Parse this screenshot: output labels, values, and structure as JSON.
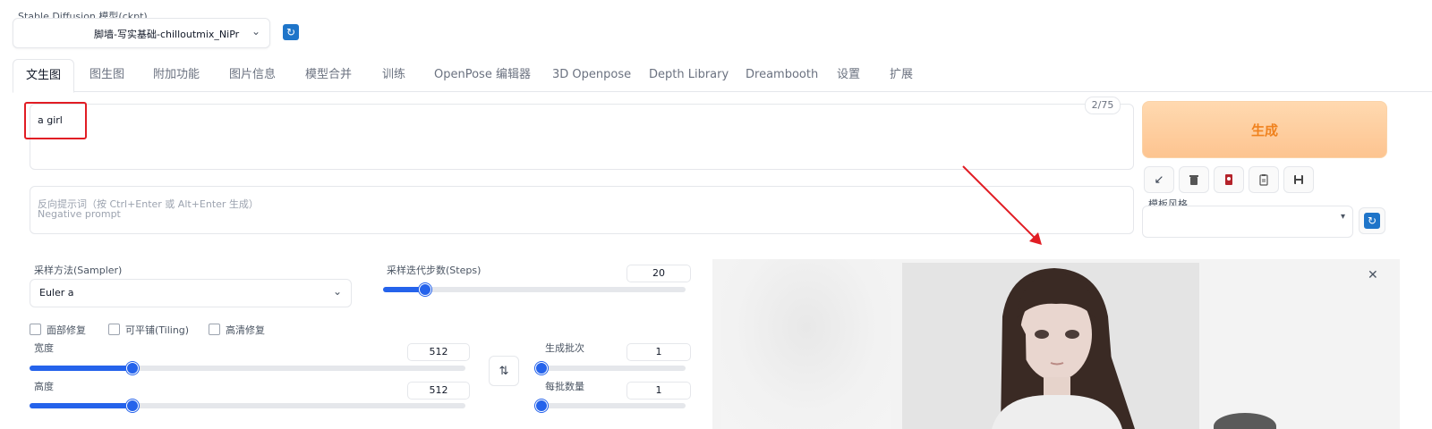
{
  "model": {
    "label": "Stable Diffusion 模型(ckpt)",
    "value": "脚墙-写实基础-chilloutmix_NiPr",
    "refresh_icon": "refresh-icon"
  },
  "tabs": [
    {
      "label": "文生图"
    },
    {
      "label": "图生图"
    },
    {
      "label": "附加功能"
    },
    {
      "label": "图片信息"
    },
    {
      "label": "模型合并"
    },
    {
      "label": "训练"
    },
    {
      "label": "OpenPose 编辑器"
    },
    {
      "label": "3D Openpose"
    },
    {
      "label": "Depth Library"
    },
    {
      "label": "Dreambooth"
    },
    {
      "label": "设置"
    },
    {
      "label": "扩展"
    }
  ],
  "prompt": {
    "value": "a girl",
    "token_counter": "2/75"
  },
  "negative_prompt": {
    "placeholder_line1": "反向提示词（按 Ctrl+Enter 或 Alt+Enter 生成）",
    "placeholder_line2": "Negative prompt"
  },
  "generate": {
    "label": "生成"
  },
  "tools": [
    "arrow-icon",
    "trash-icon",
    "card-icon",
    "clipboard-icon",
    "save-icon"
  ],
  "style": {
    "label": "模板风格",
    "value": ""
  },
  "sampler": {
    "label": "采样方法(Sampler)",
    "value": "Euler a"
  },
  "steps": {
    "label": "采样迭代步数(Steps)",
    "value": "20",
    "fraction": 0.135
  },
  "checkboxes": [
    {
      "label": "面部修复",
      "checked": false
    },
    {
      "label": "可平铺(Tiling)",
      "checked": false
    },
    {
      "label": "高清修复",
      "checked": false
    }
  ],
  "width": {
    "label": "宽度",
    "value": "512",
    "fraction": 0.235
  },
  "height": {
    "label": "高度",
    "value": "512",
    "fraction": 0.235
  },
  "batch_count": {
    "label": "生成批次",
    "value": "1",
    "fraction": 0.0
  },
  "batch_size": {
    "label": "每批数量",
    "value": "1",
    "fraction": 0.0
  },
  "colors": {
    "accent": "#2563eb",
    "generate_bg": "#fdc490",
    "generate_text": "#f0821e",
    "highlight": "#e11d24"
  }
}
